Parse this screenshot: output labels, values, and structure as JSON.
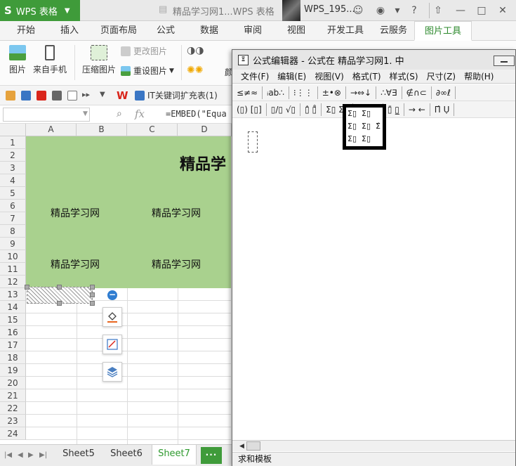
{
  "app": {
    "name": "WPS 表格",
    "logo": "S",
    "doc_title": "精品学习网1...WPS 表格",
    "user": "WPS_195..."
  },
  "tabs": [
    "开始",
    "插入",
    "页面布局",
    "公式",
    "数据",
    "审阅",
    "视图",
    "开发工具",
    "云服务",
    "图片工具"
  ],
  "active_tab": "图片工具",
  "ribbon": {
    "picture": "图片",
    "from_phone": "来自手机",
    "compress": "压缩图片",
    "change_picture": "更改图片",
    "reset_picture": "重设图片",
    "color_partial": "颜"
  },
  "quickbar": {
    "ext_label": "IT关键词扩充表(1)"
  },
  "formula_bar": {
    "name_box": "",
    "formula": "=EMBED(\"Equa"
  },
  "sheet": {
    "columns": [
      "A",
      "B",
      "C",
      "D"
    ],
    "rows": [
      "1",
      "2",
      "3",
      "4",
      "5",
      "6",
      "7",
      "8",
      "9",
      "10",
      "11",
      "12",
      "13",
      "14",
      "15",
      "16",
      "17",
      "18",
      "19",
      "20",
      "21",
      "22",
      "23",
      "24"
    ],
    "title_fragment": "精品学",
    "cells": {
      "r6a": "精品学习网",
      "r6c": "精品学习网",
      "r10a": "精品学习网",
      "r10c": "精品学习网"
    },
    "fill_color": "#a9d18e"
  },
  "sheet_tabs": [
    "Sheet5",
    "Sheet6",
    "Sheet7"
  ],
  "active_sheet": "Sheet7",
  "more_sheets": "···",
  "eq_editor": {
    "title": "公式编辑器 - 公式在 精品学习网1. 中",
    "menu": [
      "文件(F)",
      "编辑(E)",
      "视图(V)",
      "格式(T)",
      "样式(S)",
      "尺寸(Z)",
      "帮助(H)"
    ],
    "toolbar_row1": [
      "≤≠≈",
      "ᵢab∴",
      "⁝⋮⋮",
      "±•⊗",
      "→⇔↓",
      "∴∀∃",
      "∉∩⊂",
      "∂∞ℓ"
    ],
    "toolbar_row2": [
      "(▯) [▯]",
      "▯/▯ √▯",
      "▯̂ ▯̊",
      "Σ▯ Σ▯",
      "∫▯ ∮▯",
      "▯̄ ▯̲",
      "→ ←",
      "Π̂ Ụ"
    ],
    "palette": [
      "Σ▯",
      "Σ▯",
      "Σ▯",
      "Σ▯",
      "Σ̂",
      "Σ▯",
      "Σ▯"
    ],
    "status": "求和模板"
  }
}
